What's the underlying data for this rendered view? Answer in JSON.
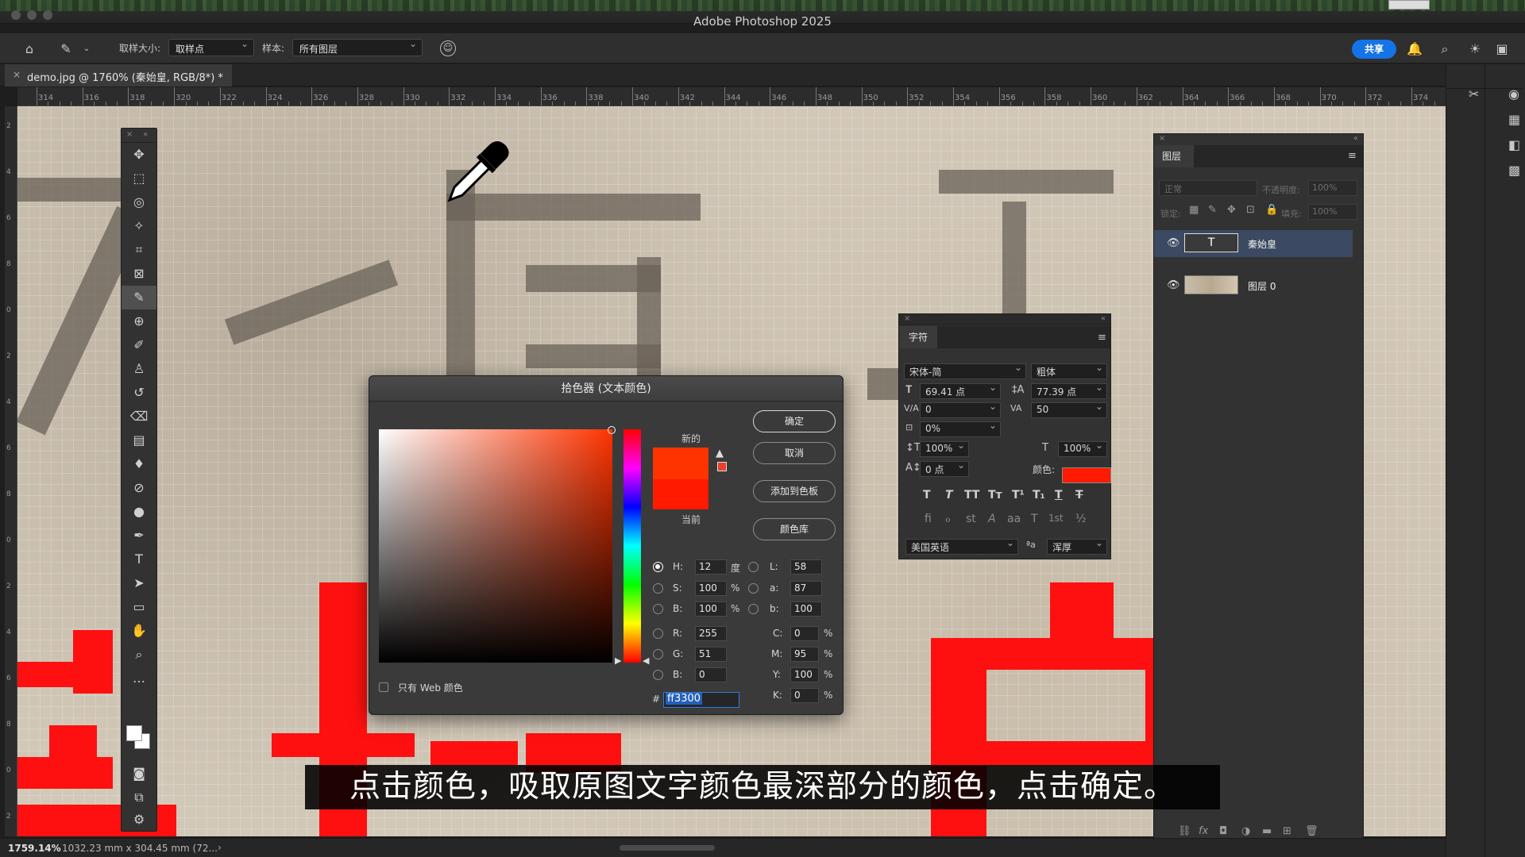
{
  "window": {
    "title": "Adobe Photoshop 2025"
  },
  "options_bar": {
    "sample_size_label": "取样大小:",
    "sample_size_value": "取样点",
    "sample_label": "样本:",
    "sample_value": "所有图层",
    "share_label": "共享"
  },
  "document": {
    "tab_title": "demo.jpg @ 1760% (秦始皇, RGB/8*) *"
  },
  "ruler": {
    "top": [
      "314",
      "316",
      "318",
      "320",
      "322",
      "324",
      "326",
      "328",
      "330",
      "332",
      "334",
      "336",
      "338",
      "340",
      "342",
      "344",
      "346",
      "348",
      "350",
      "352",
      "354",
      "356",
      "358",
      "360",
      "362",
      "364",
      "366",
      "368",
      "370",
      "372",
      "374"
    ],
    "left": [
      "2",
      "4",
      "6",
      "8",
      "0",
      "2",
      "4",
      "6",
      "8",
      "0",
      "2",
      "4",
      "6",
      "8",
      "0",
      "2"
    ]
  },
  "color_picker": {
    "title": "拾色器 (文本颜色)",
    "new_label": "新的",
    "current_label": "当前",
    "buttons": {
      "ok": "确定",
      "cancel": "取消",
      "add_to_swatches": "添加到色板",
      "color_libraries": "颜色库"
    },
    "fields": {
      "H": {
        "label": "H:",
        "value": "12",
        "unit": "度"
      },
      "S": {
        "label": "S:",
        "value": "100",
        "unit": "%"
      },
      "B": {
        "label": "B:",
        "value": "100",
        "unit": "%"
      },
      "R": {
        "label": "R:",
        "value": "255"
      },
      "G": {
        "label": "G:",
        "value": "51"
      },
      "Bl": {
        "label": "B:",
        "value": "0"
      },
      "L": {
        "label": "L:",
        "value": "58"
      },
      "a": {
        "label": "a:",
        "value": "87"
      },
      "b": {
        "label": "b:",
        "value": "100"
      },
      "C": {
        "label": "C:",
        "value": "0",
        "unit": "%"
      },
      "M": {
        "label": "M:",
        "value": "95",
        "unit": "%"
      },
      "Y": {
        "label": "Y:",
        "value": "100",
        "unit": "%"
      },
      "K": {
        "label": "K:",
        "value": "0",
        "unit": "%"
      }
    },
    "hex_label": "#",
    "hex_value": "ff3300",
    "web_only_label": "只有 Web 颜色",
    "new_color": "#ff3300",
    "current_color": "#ff1a00"
  },
  "character_panel": {
    "tab": "字符",
    "font_family": "宋体-简",
    "font_style": "粗体",
    "font_size": "69.41 点",
    "leading": "77.39 点",
    "kerning": "0",
    "tracking": "50",
    "tsume": "0%",
    "vertical_scale": "100%",
    "horizontal_scale": "100%",
    "baseline_shift": "0 点",
    "color_label": "颜色:",
    "language": "美国英语",
    "anti_alias": "浑厚",
    "style_buttons": [
      "T",
      "T",
      "TT",
      "Tт",
      "T¹",
      "T₁",
      "T",
      "T"
    ],
    "opentype_buttons": [
      "fi",
      "ℴ",
      "st",
      "A",
      "aa",
      "T",
      "1st",
      "½"
    ],
    "text_color": "#ff1a00"
  },
  "layers_panel": {
    "tab": "图层",
    "blend_mode": "正常",
    "opacity_label": "不透明度:",
    "opacity_value": "100%",
    "lock_label": "锁定:",
    "fill_label": "填充:",
    "fill_value": "100%",
    "layers": [
      {
        "name": "秦始皇",
        "type": "text",
        "selected": true
      },
      {
        "name": "图层 0",
        "type": "image",
        "selected": false
      }
    ]
  },
  "status_bar": {
    "zoom": "1759.14%",
    "doc_size": "1032.23 mm x 304.45 mm (72..."
  },
  "subtitle": "点击颜色，吸取原图文字颜色最深部分的颜色，点击确定。",
  "colors": {
    "accent": "#1473e6",
    "text_red": "#ff1a00",
    "hex_highlight": "#2460b8"
  }
}
